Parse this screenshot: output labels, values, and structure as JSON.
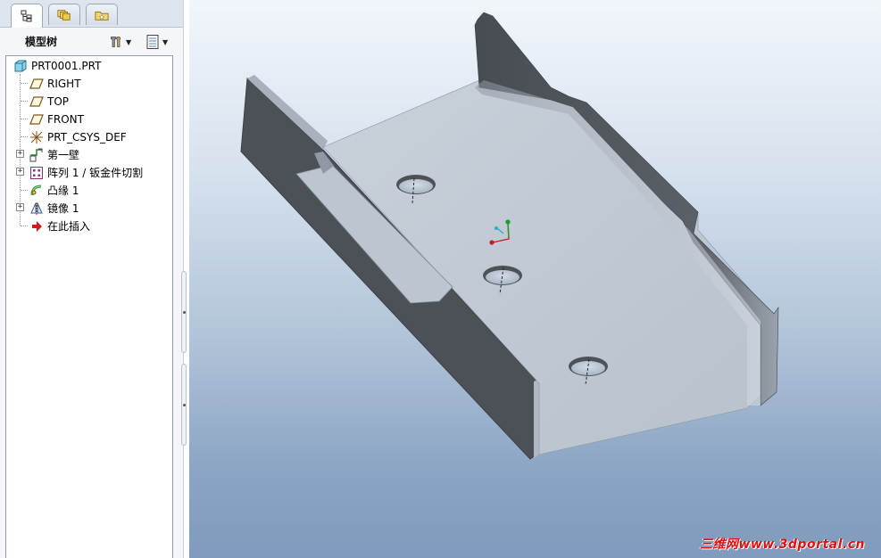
{
  "tabs": [
    {
      "icon": "model-tree-icon",
      "active": true
    },
    {
      "icon": "layers-icon",
      "active": false
    },
    {
      "icon": "favorites-folder-icon",
      "active": false
    }
  ],
  "tree_header": {
    "title": "模型树",
    "settings_icon": "tools-icon",
    "show_icon": "list-icon"
  },
  "tree": {
    "root": {
      "label": "PRT0001.PRT",
      "icon": "part-icon"
    },
    "items": [
      {
        "label": "RIGHT",
        "icon": "datum-plane-icon",
        "expandable": false
      },
      {
        "label": "TOP",
        "icon": "datum-plane-icon",
        "expandable": false
      },
      {
        "label": "FRONT",
        "icon": "datum-plane-icon",
        "expandable": false
      },
      {
        "label": "PRT_CSYS_DEF",
        "icon": "coordinate-system-icon",
        "expandable": false
      },
      {
        "label": "第一壁",
        "icon": "first-wall-icon",
        "expandable": true
      },
      {
        "label": "阵列 1 / 钣金件切割",
        "icon": "pattern-icon",
        "expandable": true
      },
      {
        "label": "凸缘 1",
        "icon": "flange-icon",
        "expandable": false
      },
      {
        "label": "镜像 1",
        "icon": "mirror-icon",
        "expandable": true
      },
      {
        "label": "在此插入",
        "icon": "insert-here-arrow-icon",
        "expandable": false
      }
    ]
  },
  "colors": {
    "accent_insert": "#d21a1a",
    "part_face": "#c3ccd5",
    "part_side": "#4f545a",
    "viewport_top": "#f2f6fb",
    "viewport_bottom": "#7f9bbd"
  },
  "viewport": {
    "watermark": "三维网www.3dportal.cn"
  }
}
